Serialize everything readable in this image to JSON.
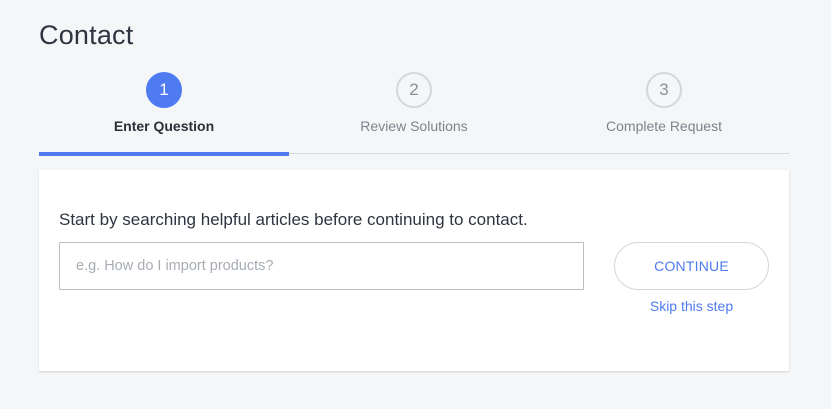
{
  "page": {
    "title": "Contact"
  },
  "stepper": {
    "steps": [
      {
        "number": "1",
        "label": "Enter Question",
        "state": "active"
      },
      {
        "number": "2",
        "label": "Review Solutions",
        "state": "inactive"
      },
      {
        "number": "3",
        "label": "Complete Request",
        "state": "inactive"
      }
    ],
    "active_color": "#4f7bf0"
  },
  "form": {
    "intro_text": "Start by searching helpful articles before continuing to contact.",
    "search": {
      "value": "",
      "placeholder": "e.g. How do I import products?"
    },
    "continue_label": "CONTINUE",
    "skip_label": "Skip this step"
  }
}
